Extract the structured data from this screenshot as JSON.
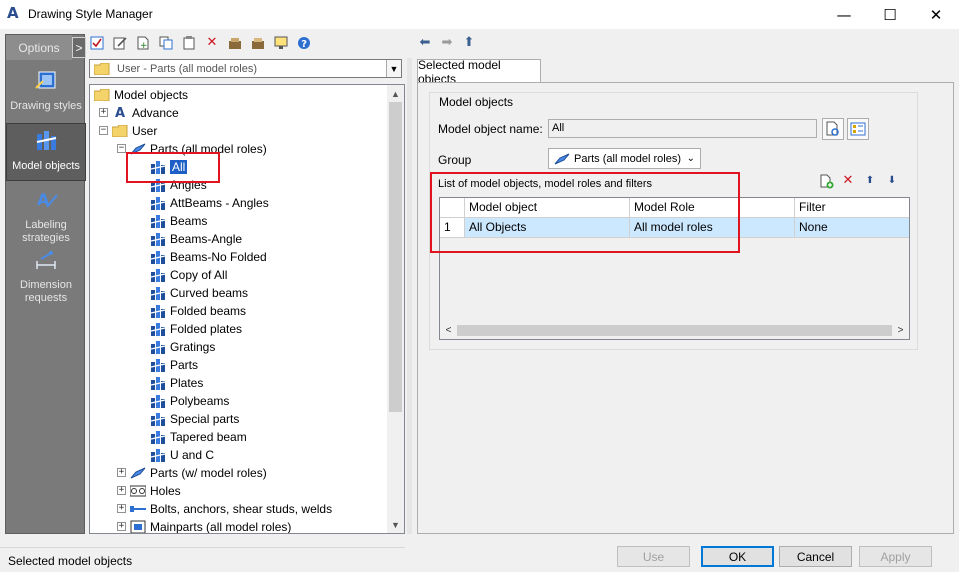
{
  "window": {
    "title": "Drawing Style Manager",
    "app_icon": "A",
    "minimize": "—",
    "maximize": "☐",
    "close": "✕"
  },
  "sidebar": {
    "options_label": "Options",
    "options_arrow": ">",
    "items": [
      {
        "label": "Drawing styles",
        "icon": "drawing-styles-icon"
      },
      {
        "label": "Model objects",
        "icon": "model-objects-icon",
        "active": true
      },
      {
        "label": "Labeling strategies",
        "icon": "labeling-icon"
      },
      {
        "label": "Dimension requests",
        "icon": "dimension-icon"
      }
    ]
  },
  "combo": {
    "value": "User - Parts (all model roles)"
  },
  "tree": {
    "root": "Model objects",
    "advance": "Advance",
    "user": "User",
    "parts_all": "Parts (all model roles)",
    "leaves": [
      "All",
      "Angles",
      "AttBeams - Angles",
      "Beams",
      "Beams-Angle",
      "Beams-No Folded",
      "Copy of All",
      "Curved beams",
      "Folded beams",
      "Folded plates",
      "Gratings",
      "Parts",
      "Plates",
      "Polybeams",
      "Special parts",
      "Tapered beam",
      "U and C"
    ],
    "groups": [
      "Parts (w/ model roles)",
      "Holes",
      "Bolts, anchors, shear studs, welds",
      "Mainparts (all model roles)"
    ]
  },
  "right": {
    "tab_label": "Selected model objects",
    "group_title": "Model objects",
    "name_label": "Model object name:",
    "name_value": "All",
    "group_label": "Group",
    "group_value": "Parts (all model roles)",
    "list_label": "List of model objects, model roles and filters",
    "columns": [
      "",
      "Model object",
      "Model Role",
      "Filter"
    ],
    "rows": [
      [
        "1",
        "All Objects",
        "All model roles",
        "None"
      ]
    ]
  },
  "status": {
    "text": "Selected model objects"
  },
  "buttons": {
    "use": "Use",
    "ok": "OK",
    "cancel": "Cancel",
    "apply": "Apply"
  },
  "colors": {
    "selection": "#1e5fc7",
    "highlight": "#e0141e",
    "sidebar": "#7a7a7a",
    "row_selected": "#cce8ff"
  }
}
